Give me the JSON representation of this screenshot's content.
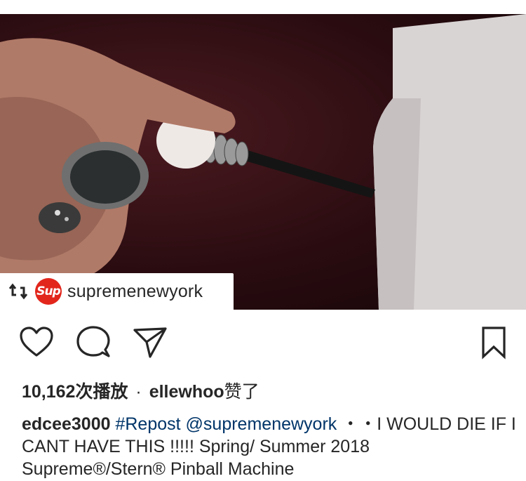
{
  "post": {
    "repost_username": "supremenewyork",
    "logo_text": "Sup",
    "views": "10,162次播放",
    "separator": "·",
    "liker": "ellewhoo",
    "liked_suffix": "赞了",
    "caption_user": "edcee3000",
    "hashtag": "#Repost",
    "mention": "@supremenewyork",
    "caption_text": " ・・I WOULD DIE IF I CANT HAVE THIS !!!!! Spring/ Summer 2018 Supreme®/Stern® Pinball Machine"
  },
  "icons": {
    "repost": "repost-icon",
    "like": "heart-icon",
    "comment": "comment-bubble-icon",
    "share": "paper-plane-icon",
    "save": "bookmark-icon"
  },
  "colors": {
    "brand_red": "#e2261c",
    "text": "#262626",
    "link": "#003569"
  }
}
